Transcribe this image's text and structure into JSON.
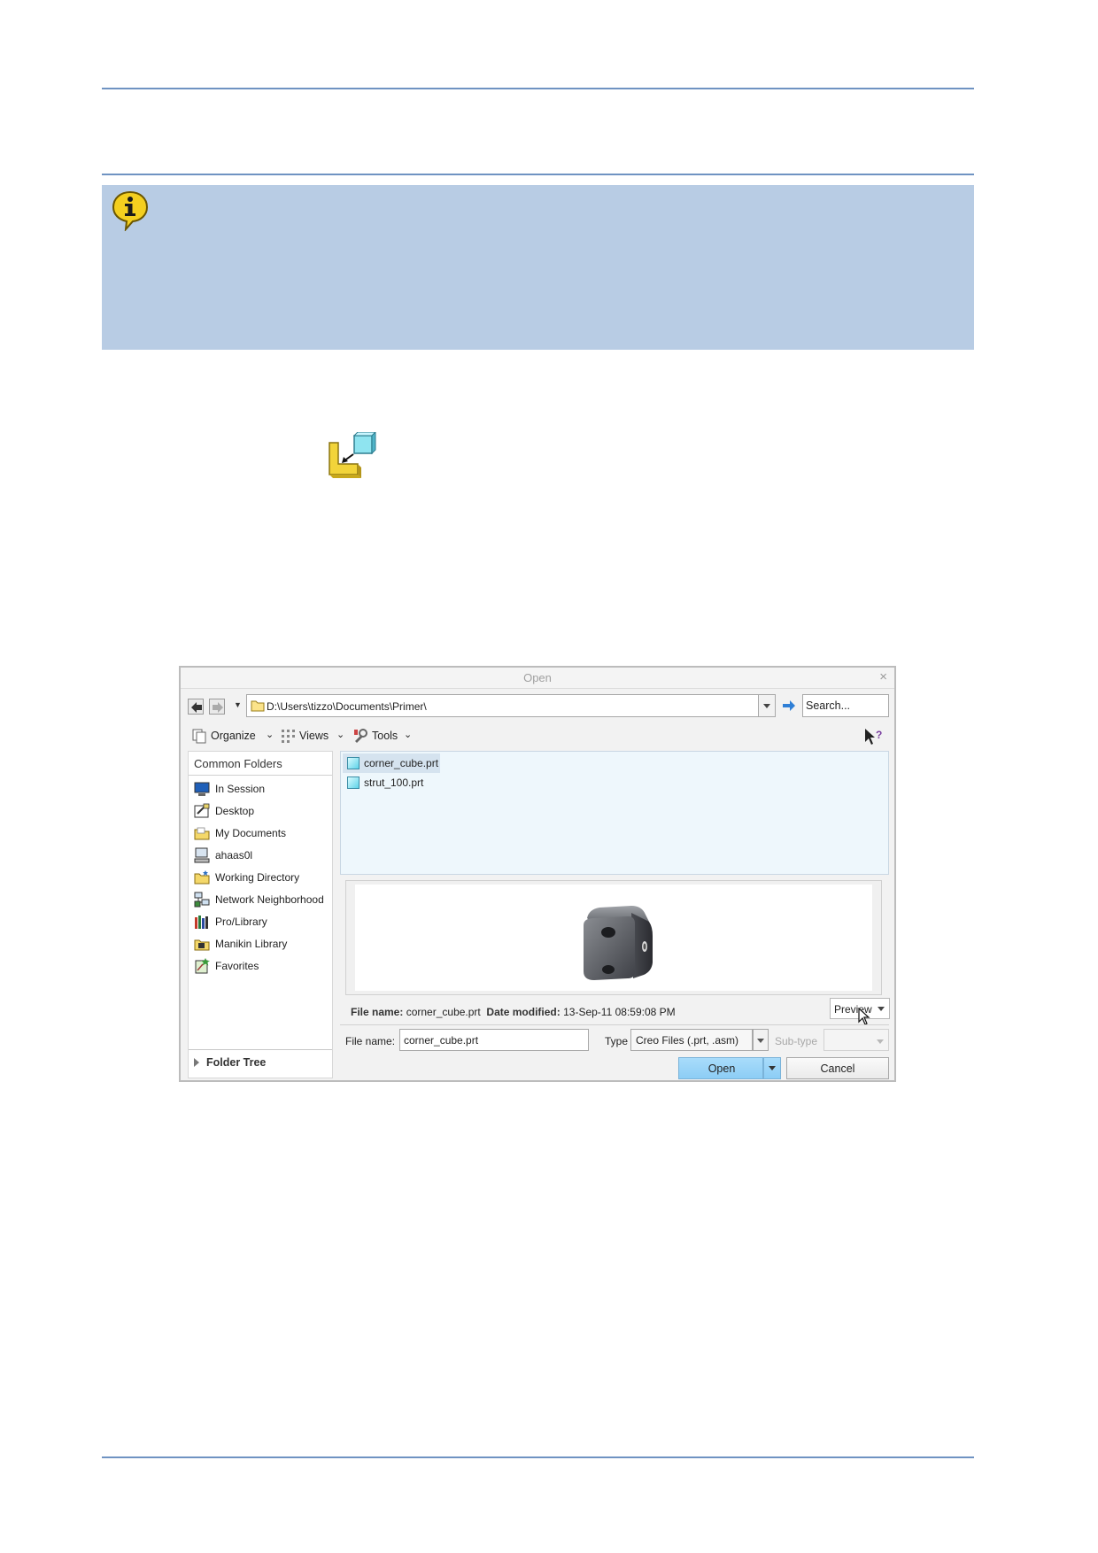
{
  "dialog": {
    "title": "Open",
    "close_glyph": "×",
    "path": "D:\\Users\\tizzo\\Documents\\Primer\\",
    "search_placeholder": "Search...",
    "toolbar": {
      "organize": "Organize",
      "views": "Views",
      "tools": "Tools"
    },
    "sidebar": {
      "heading": "Common Folders",
      "items": [
        {
          "label": "In Session",
          "icon": "monitor-icon"
        },
        {
          "label": "Desktop",
          "icon": "desktop-icon"
        },
        {
          "label": "My Documents",
          "icon": "my-documents-icon"
        },
        {
          "label": "ahaas0l",
          "icon": "computer-icon"
        },
        {
          "label": "Working Directory",
          "icon": "working-directory-icon"
        },
        {
          "label": "Network Neighborhood",
          "icon": "network-icon"
        },
        {
          "label": "Pro/Library",
          "icon": "library-icon"
        },
        {
          "label": "Manikin Library",
          "icon": "manikin-library-icon"
        },
        {
          "label": "Favorites",
          "icon": "favorites-icon"
        }
      ],
      "folder_tree": "Folder Tree"
    },
    "files": [
      {
        "name": "corner_cube.prt",
        "selected": true
      },
      {
        "name": "strut_100.prt",
        "selected": false
      }
    ],
    "info": {
      "file_name_label": "File name:",
      "file_name": "corner_cube.prt",
      "date_label": "Date modified:",
      "date": "13-Sep-11 08:59:08 PM"
    },
    "preview_button": "Preview",
    "form": {
      "file_name_label": "File name:",
      "file_name_value": "corner_cube.prt",
      "type_label": "Type",
      "type_value": "Creo Files (.prt, .asm)",
      "subtype_label": "Sub-type"
    },
    "buttons": {
      "open": "Open",
      "cancel": "Cancel"
    }
  },
  "colors": {
    "rule": "#6f93c2",
    "note_background": "#b8cce4",
    "open_button": "#a9dcfb"
  }
}
